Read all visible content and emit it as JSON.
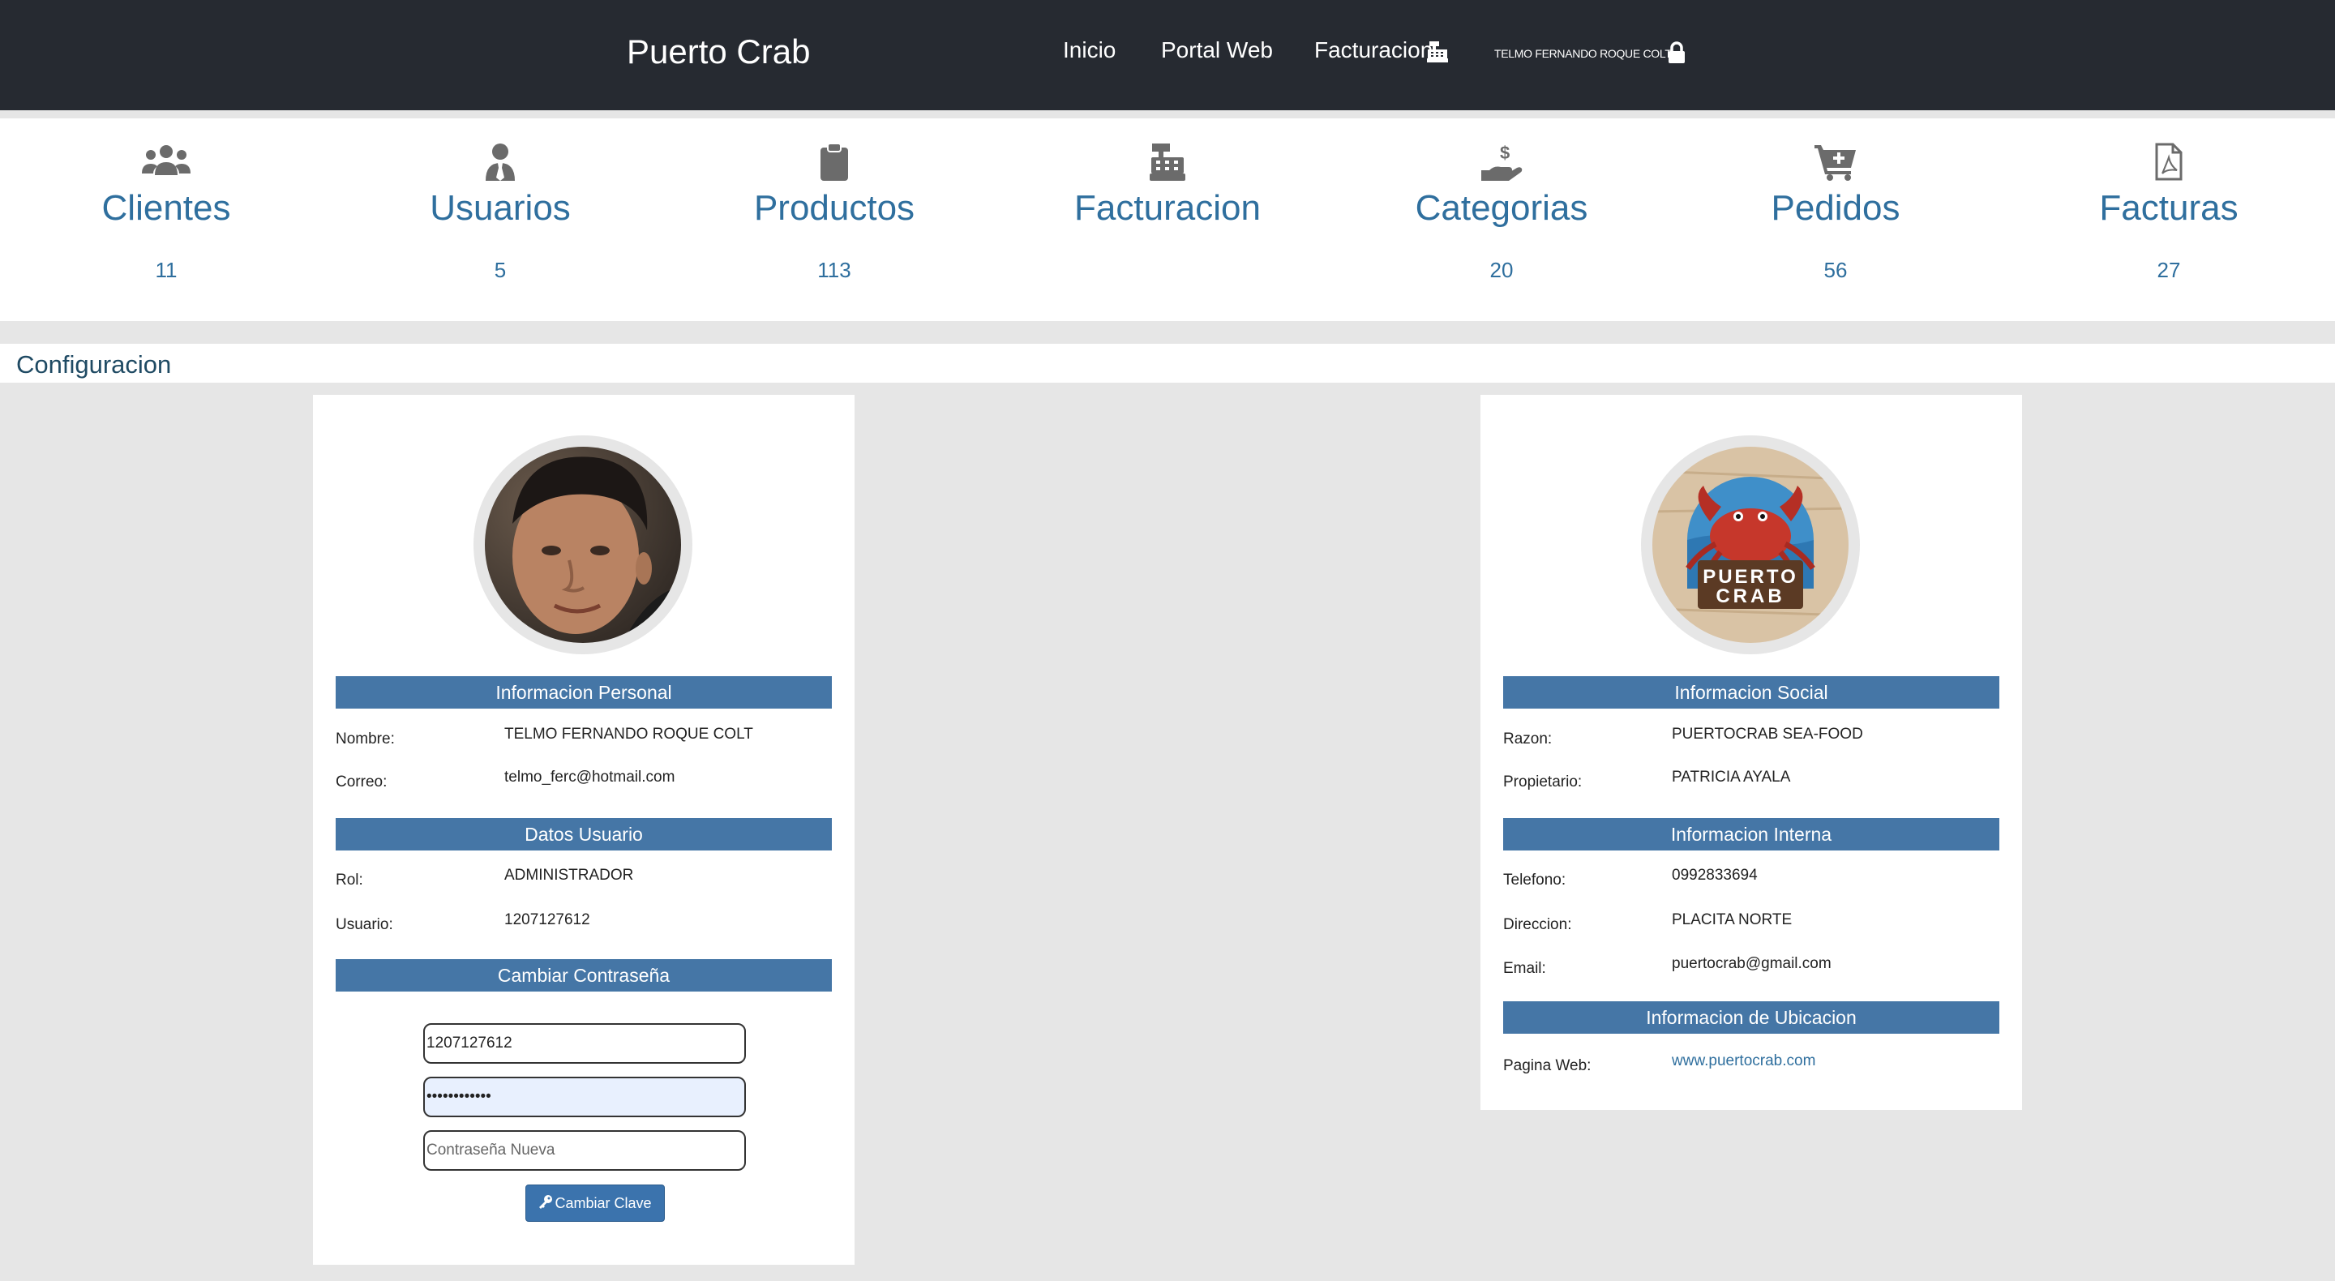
{
  "navbar": {
    "brand": "Puerto Crab",
    "links": [
      {
        "label": "Inicio"
      },
      {
        "label": "Portal Web"
      },
      {
        "label": "Facturacion"
      }
    ],
    "user": "TELMO FERNANDO ROQUE COLT"
  },
  "stats": [
    {
      "title": "Clientes",
      "count": "11",
      "icon": "users-icon"
    },
    {
      "title": "Usuarios",
      "count": "5",
      "icon": "user-tie-icon"
    },
    {
      "title": "Productos",
      "count": "113",
      "icon": "clipboard-icon"
    },
    {
      "title": "Facturacion",
      "count": "",
      "icon": "cash-register-icon"
    },
    {
      "title": "Categorias",
      "count": "20",
      "icon": "hand-dollar-icon"
    },
    {
      "title": "Pedidos",
      "count": "56",
      "icon": "cart-plus-icon"
    },
    {
      "title": "Facturas",
      "count": "27",
      "icon": "file-pdf-icon"
    }
  ],
  "section": {
    "title": "Configuracion"
  },
  "personal_card": {
    "band_personal": "Informacion Personal",
    "nombre_label": "Nombre:",
    "nombre_value": "TELMO FERNANDO ROQUE COLT",
    "correo_label": "Correo:",
    "correo_value": "telmo_ferc@hotmail.com",
    "band_usuario": "Datos Usuario",
    "rol_label": "Rol:",
    "rol_value": "ADMINISTRADOR",
    "usuario_label": "Usuario:",
    "usuario_value": "1207127612",
    "band_password": "Cambiar Contraseña",
    "username_input_value": "1207127612",
    "password_input_value": "123456789012",
    "new_password_placeholder": "Contraseña Nueva",
    "change_button": "Cambiar Clave"
  },
  "company_card": {
    "band_social": "Informacion Social",
    "razon_label": "Razon:",
    "razon_value": "PUERTOCRAB SEA-FOOD",
    "propietario_label": "Propietario:",
    "propietario_value": "PATRICIA AYALA",
    "band_interna": "Informacion Interna",
    "telefono_label": "Telefono:",
    "telefono_value": "0992833694",
    "direccion_label": "Direccion:",
    "direccion_value": "PLACITA NORTE",
    "email_label": "Email:",
    "email_value": "puertocrab@gmail.com",
    "band_ubicacion": "Informacion de Ubicacion",
    "web_label": "Pagina Web:",
    "web_value": "www.puertocrab.com",
    "logo_text_line1": "PUERTO",
    "logo_text_line2": "CRAB"
  },
  "colors": {
    "navbar": "#262a31",
    "accent": "#2f6f9e",
    "band": "#4576a6",
    "button": "#3b73ad",
    "background": "#e6e6e6"
  }
}
